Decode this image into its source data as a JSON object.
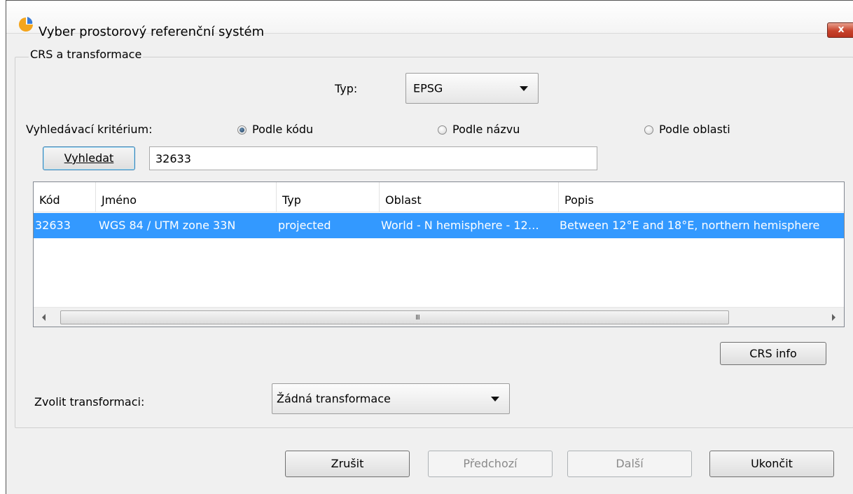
{
  "window": {
    "title": "Vyber prostorový referenční systém",
    "close_label": "x"
  },
  "group": {
    "title": "CRS a transformace"
  },
  "type_row": {
    "label": "Typ:",
    "value": "EPSG"
  },
  "search": {
    "criterion_label": "Vyhledávací kritérium:",
    "options": [
      {
        "label": "Podle kódu",
        "checked": true
      },
      {
        "label": "Podle názvu",
        "checked": false
      },
      {
        "label": "Podle oblasti",
        "checked": false
      }
    ],
    "button_label": "Vyhledat",
    "query": "32633"
  },
  "table": {
    "columns": [
      "Kód",
      "Jméno",
      "Typ",
      "Oblast",
      "Popis"
    ],
    "rows": [
      [
        "32633",
        "WGS 84 / UTM zone 33N",
        "projected",
        "World - N hemisphere - 12…",
        "Between 12°E and 18°E, northern hemisphere"
      ]
    ],
    "scroll_grip": "III"
  },
  "crs_info_button": "CRS info",
  "transform": {
    "label": "Zvolit transformaci:",
    "value": "Žádná transformace"
  },
  "footer": {
    "cancel": "Zrušit",
    "previous": "Předchozí",
    "next": "Další",
    "finish": "Ukončit"
  },
  "colors": {
    "selection": "#3399ff",
    "dialog_bg": "#f0f0f0",
    "close_button": "#c7422b"
  }
}
